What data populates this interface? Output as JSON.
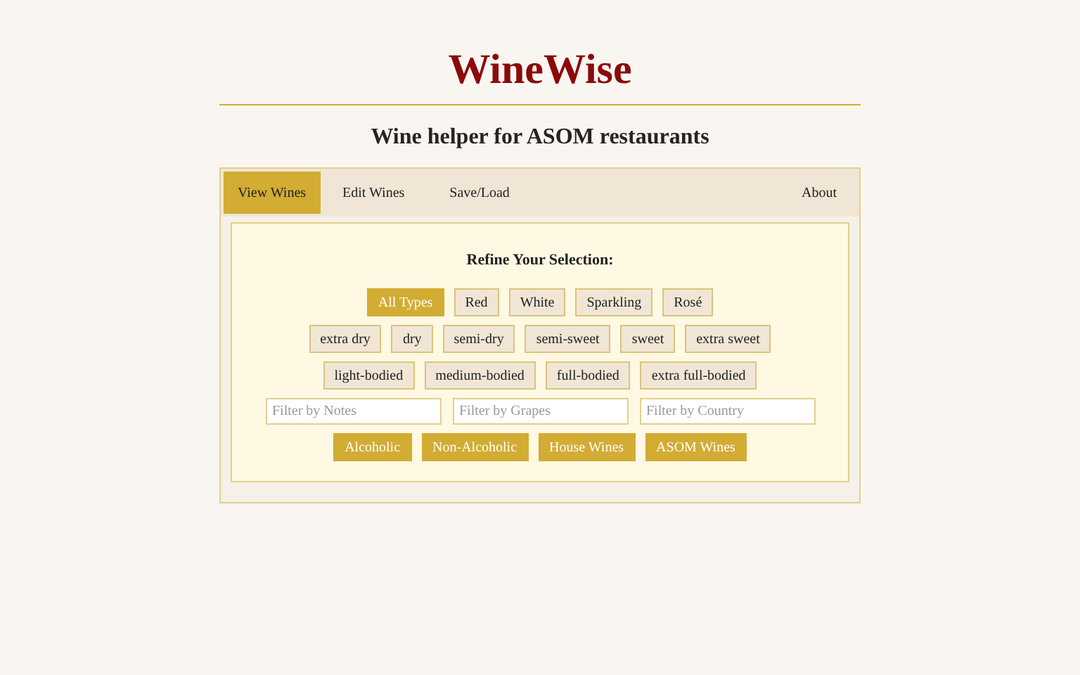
{
  "header": {
    "title": "WineWise",
    "subtitle": "Wine helper for ASOM restaurants"
  },
  "tabs": [
    {
      "label": "View Wines",
      "selected": true
    },
    {
      "label": "Edit Wines",
      "selected": false
    },
    {
      "label": "Save/Load",
      "selected": false
    }
  ],
  "about_tab": {
    "label": "About",
    "selected": false
  },
  "filters": {
    "heading": "Refine Your Selection:",
    "types": [
      {
        "label": "All Types",
        "selected": true
      },
      {
        "label": "Red",
        "selected": false
      },
      {
        "label": "White",
        "selected": false
      },
      {
        "label": "Sparkling",
        "selected": false
      },
      {
        "label": "Rosé",
        "selected": false
      }
    ],
    "sweetness": [
      {
        "label": "extra dry",
        "selected": false
      },
      {
        "label": "dry",
        "selected": false
      },
      {
        "label": "semi-dry",
        "selected": false
      },
      {
        "label": "semi-sweet",
        "selected": false
      },
      {
        "label": "sweet",
        "selected": false
      },
      {
        "label": "extra sweet",
        "selected": false
      }
    ],
    "body": [
      {
        "label": "light-bodied",
        "selected": false
      },
      {
        "label": "medium-bodied",
        "selected": false
      },
      {
        "label": "full-bodied",
        "selected": false
      },
      {
        "label": "extra full-bodied",
        "selected": false
      }
    ],
    "fields": [
      {
        "placeholder": "Filter by Notes"
      },
      {
        "placeholder": "Filter by Grapes"
      },
      {
        "placeholder": "Filter by Country"
      }
    ],
    "categories": [
      {
        "label": "Alcoholic",
        "selected": true
      },
      {
        "label": "Non-Alcoholic",
        "selected": true
      },
      {
        "label": "House Wines",
        "selected": true
      },
      {
        "label": "ASOM Wines",
        "selected": true
      }
    ]
  }
}
